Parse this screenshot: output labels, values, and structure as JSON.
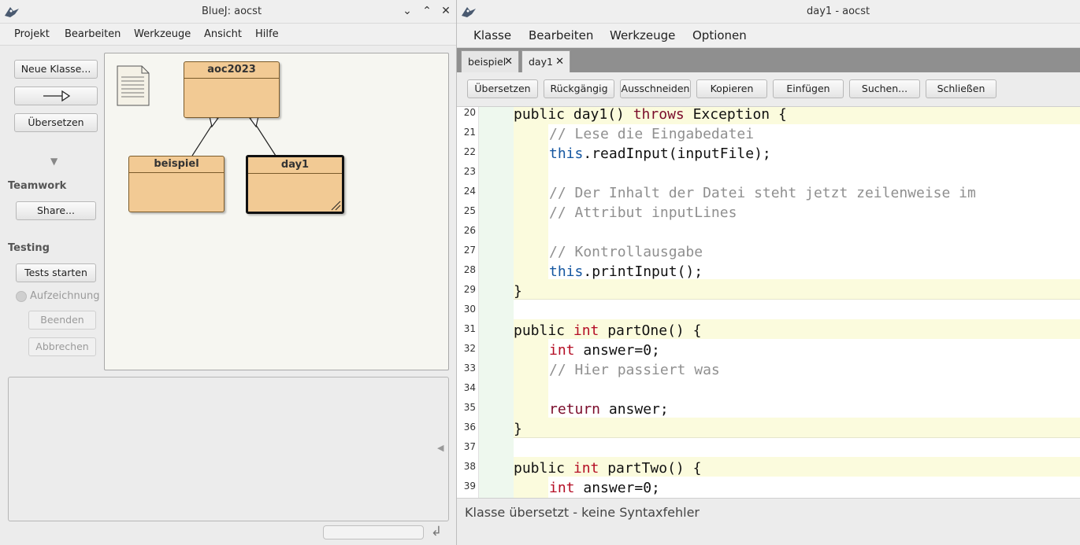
{
  "left_window": {
    "title": "BlueJ: aocst",
    "menu": [
      "Projekt",
      "Bearbeiten",
      "Werkzeuge",
      "Ansicht",
      "Hilfe"
    ],
    "buttons": {
      "new_class": "Neue Klasse...",
      "compile": "Übersetzen"
    },
    "teamwork": {
      "heading": "Teamwork",
      "share": "Share..."
    },
    "testing": {
      "heading": "Testing",
      "run_tests": "Tests starten",
      "recording": "Aufzeichnung",
      "end": "Beenden",
      "cancel": "Abbrechen"
    },
    "classes": {
      "superclass": "aoc2023",
      "sub1": "beispiel",
      "sub2": "day1"
    }
  },
  "right_window": {
    "title": "day1 - aocst",
    "menu": [
      "Klasse",
      "Bearbeiten",
      "Werkzeuge",
      "Optionen"
    ],
    "tabs": [
      "beispiel",
      "day1"
    ],
    "active_tab": "day1",
    "toolbar": [
      "Übersetzen",
      "Rückgängig",
      "Ausschneiden",
      "Kopieren",
      "Einfügen",
      "Suchen...",
      "Schließen"
    ],
    "status": "Klasse übersetzt - keine Syntaxfehler",
    "line_numbers": [
      "20",
      "21",
      "22",
      "23",
      "24",
      "25",
      "26",
      "27",
      "28",
      "29",
      "30",
      "31",
      "32",
      "33",
      "34",
      "35",
      "36",
      "37",
      "38",
      "39"
    ],
    "code": {
      "l20": [
        "public day1() ",
        "throws",
        " Exception {"
      ],
      "l21": "// Lese die Eingabedatei",
      "l22": [
        "this",
        ".readInput(inputFile);"
      ],
      "l24": "// Der Inhalt der Datei steht jetzt zeilenweise im",
      "l25": "// Attribut inputLines",
      "l27": "// Kontrollausgabe",
      "l28": [
        "this",
        ".printInput();"
      ],
      "l29": "}",
      "l31": [
        "public ",
        "int",
        " partOne() {"
      ],
      "l32": [
        "int",
        " answer=0;"
      ],
      "l33": "// Hier passiert was",
      "l35": [
        "return",
        " answer;"
      ],
      "l36": "}",
      "l38": [
        "public ",
        "int",
        " partTwo() {"
      ],
      "l39": [
        "int",
        " answer=0;"
      ]
    }
  },
  "colors": {
    "class_fill": "#f2ca94",
    "scope_outer": "#fbfbdd",
    "scope_gutter": "#eef8ee",
    "keyword": "#7a0b2a",
    "type": "#b40d24",
    "comment": "#8f8f8f",
    "this": "#1456a0"
  }
}
